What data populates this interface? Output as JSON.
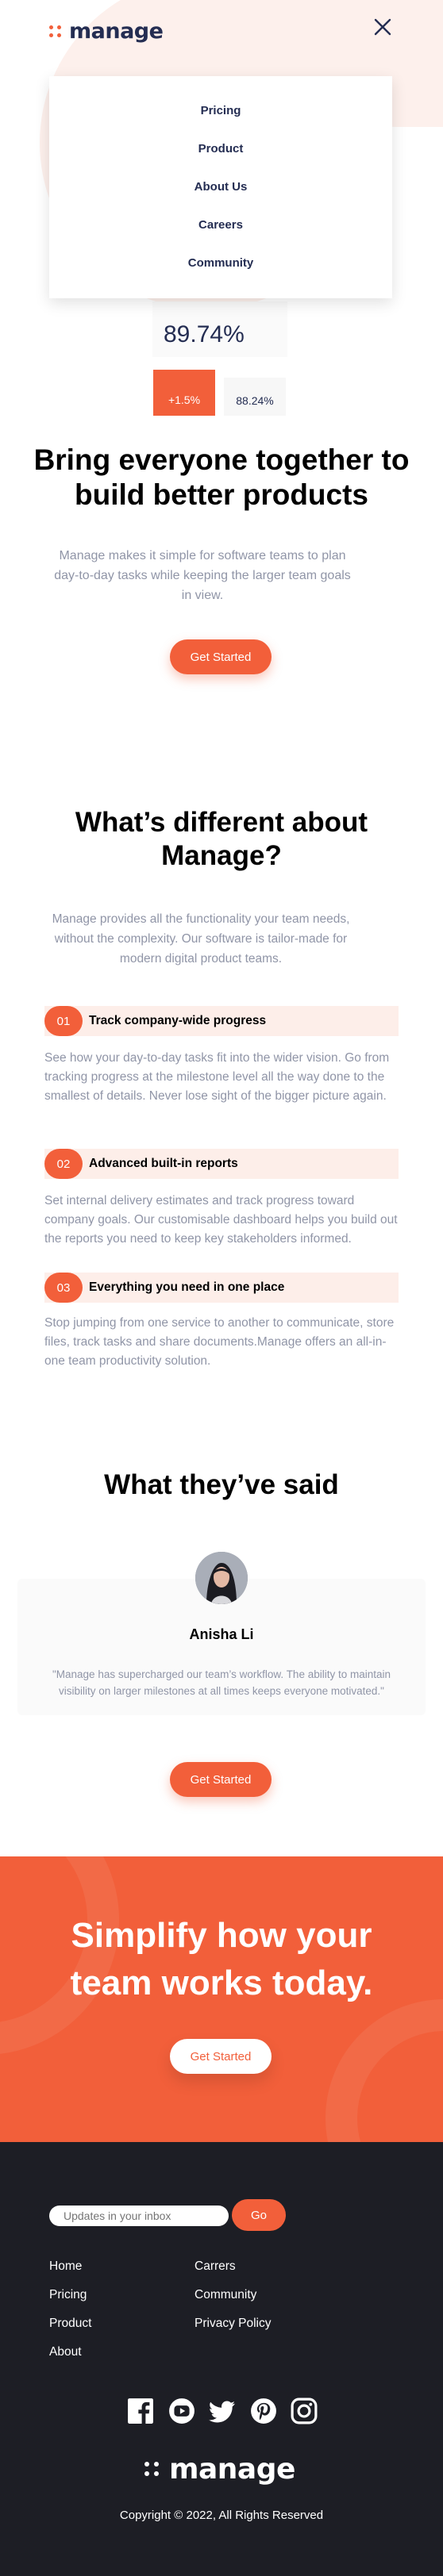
{
  "brand": {
    "name": "manage",
    "accent": "#f25f3a",
    "dark": "#242d52",
    "footer_bg": "#1d1e25"
  },
  "header": {
    "logo_text": "manage",
    "close_icon": "close-icon"
  },
  "menu": {
    "items": [
      "Pricing",
      "Product",
      "About Us",
      "Careers",
      "Community"
    ]
  },
  "dashboard_preview": {
    "big_stat": "89.74%",
    "badge_up": "+1.5%",
    "badge_value": "88.24%"
  },
  "hero": {
    "title": "Bring everyone together to build better products",
    "text": "Manage makes it simple for software teams to plan day-to-day tasks while keeping the larger team goals in view.",
    "cta_label": "Get Started"
  },
  "features": {
    "title": "What’s different about Manage?",
    "intro": "Manage provides all the functionality your team needs, without the complexity. Our software is tailor-made for modern digital product teams.",
    "items": [
      {
        "num": "01",
        "title": "Track company-wide progress",
        "text": "See how your day-to-day tasks fit into the wider vision. Go from tracking progress at the milestone level all the way done to the smallest of details. Never lose sight of the bigger picture again."
      },
      {
        "num": "02",
        "title": "Advanced built-in reports",
        "text": "Set internal delivery estimates and track progress toward company goals. Our customisable dashboard helps you build out the reports you need to keep key stakeholders informed."
      },
      {
        "num": "03",
        "title": "Everything you need in one place",
        "text": "Stop jumping from one service to another to communicate, store files, track tasks and share documents.Manage offers an all-in-one team productivity solution."
      }
    ]
  },
  "testimonials": {
    "title": "What they’ve said",
    "name": "Anisha Li",
    "quote": "\"Manage has supercharged our team’s workflow. The ability to maintain visibility on larger milestones at all times keeps everyone motivated.\"",
    "cta_label": "Get Started"
  },
  "cta_banner": {
    "title": "Simplify how your team works today.",
    "cta_label": "Get Started"
  },
  "footer": {
    "newsletter_placeholder": "Updates in your inbox",
    "go_label": "Go",
    "links_col1": [
      "Home",
      "Pricing",
      "Product",
      "About"
    ],
    "links_col2": [
      "Carrers",
      "Community",
      "Privacy Policy"
    ],
    "socials": [
      "facebook-icon",
      "youtube-icon",
      "twitter-icon",
      "pinterest-icon",
      "instagram-icon"
    ],
    "logo_text": "manage",
    "copyright": "Copyright © 2022, All Rights Reserved"
  }
}
